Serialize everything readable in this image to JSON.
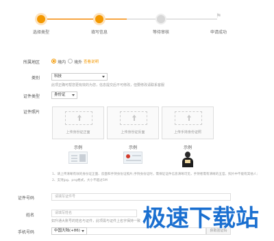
{
  "steps": [
    {
      "label": "选择类型",
      "state": "done"
    },
    {
      "label": "填写信息",
      "state": "active"
    },
    {
      "label": "等待审核",
      "state": "pending"
    },
    {
      "label": "申请成功",
      "state": "pending"
    }
  ],
  "region": {
    "label": "所属地区",
    "options": [
      "境内",
      "境外"
    ],
    "selected": "境内",
    "link": "查看说明"
  },
  "category": {
    "label": "类别",
    "value": "科技",
    "hint": "此项正确可帮您更有效的为您，信息提交后不可修改，但要修改请联系客服"
  },
  "id_type": {
    "label": "证件类型",
    "value": "身份证"
  },
  "id_photo": {
    "label": "证件照片",
    "uploads": [
      "上传身份证正面",
      "上传身份证反面",
      "上传手持身份证照"
    ],
    "sample_label": "示例",
    "notes": [
      "1、请上传清晰有效的身份证正面、反面和手持身份证照片;手持身份证时，需保证证件信息清晰可见，手持者需有清晰的五官，照片中不能有其他人;",
      "2、支持jpg、png格式，大小不超过5M"
    ]
  },
  "id_number": {
    "label": "证件号码",
    "placeholder": "请填写证件号"
  },
  "name": {
    "label": "姓名",
    "placeholder": "请填写姓名",
    "hint": "如升通大账号的姓名与证件，此项需与证件上名字保持一致"
  },
  "phone": {
    "label": "手机号码",
    "country": "中国大陆(+86)",
    "code_button": "获取验证码"
  },
  "watermark": "极速下载站",
  "colors": {
    "accent": "#f39800",
    "watermark": "#1a6fd0"
  }
}
